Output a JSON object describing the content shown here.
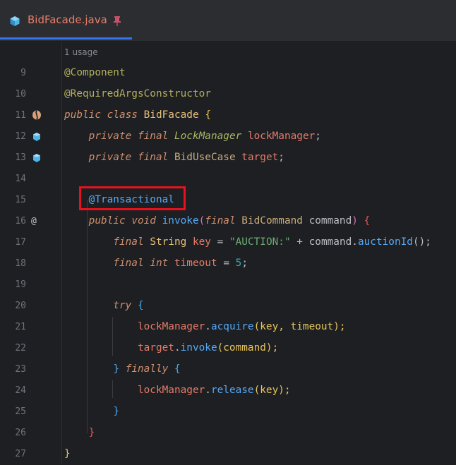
{
  "tab": {
    "title": "BidFacade.java",
    "icon": "java-file-icon",
    "pinned": true
  },
  "editor": {
    "usage_hint": "1 usage",
    "lines": [
      {
        "number": "9",
        "gutter_icon": ""
      },
      {
        "number": "10",
        "gutter_icon": ""
      },
      {
        "number": "11",
        "gutter_icon": "spring-bean-icon"
      },
      {
        "number": "12",
        "gutter_icon": "injection-icon"
      },
      {
        "number": "13",
        "gutter_icon": "injection-icon"
      },
      {
        "number": "14",
        "gutter_icon": ""
      },
      {
        "number": "15",
        "gutter_icon": ""
      },
      {
        "number": "16",
        "gutter_icon": "@"
      },
      {
        "number": "17",
        "gutter_icon": ""
      },
      {
        "number": "18",
        "gutter_icon": ""
      },
      {
        "number": "19",
        "gutter_icon": ""
      },
      {
        "number": "20",
        "gutter_icon": ""
      },
      {
        "number": "21",
        "gutter_icon": ""
      },
      {
        "number": "22",
        "gutter_icon": ""
      },
      {
        "number": "23",
        "gutter_icon": ""
      },
      {
        "number": "24",
        "gutter_icon": ""
      },
      {
        "number": "25",
        "gutter_icon": ""
      },
      {
        "number": "26",
        "gutter_icon": ""
      },
      {
        "number": "27",
        "gutter_icon": ""
      }
    ],
    "code": {
      "l9": {
        "ann": "@Component"
      },
      "l10": {
        "ann": "@RequiredArgsConstructor"
      },
      "l11": {
        "kw1": "public",
        "kw2": "class",
        "cls": "BidFacade",
        "brace": "{"
      },
      "l12": {
        "kw1": "private",
        "kw2": "final",
        "type": "LockManager",
        "field": "lockManager",
        "end": ";"
      },
      "l13": {
        "kw1": "private",
        "kw2": "final",
        "type": "BidUseCase",
        "field": "target",
        "end": ";"
      },
      "l15": {
        "ann": "@Transactional"
      },
      "l16": {
        "kw1": "public",
        "kw2": "void",
        "fn": "invoke",
        "open": "(",
        "kw3": "final",
        "type": "BidCommand",
        "param": "command",
        "close": ")",
        "brace": "{"
      },
      "l17": {
        "kw": "final",
        "type": "String",
        "var": "key",
        "eq": "=",
        "str": "\"AUCTION:\"",
        "plus": "+",
        "obj": "command",
        "dot": ".",
        "fn": "auctionId",
        "call": "();"
      },
      "l18": {
        "kw1": "final",
        "kw2": "int",
        "var": "timeout",
        "eq": "=",
        "num": "5",
        "end": ";"
      },
      "l20": {
        "kw": "try",
        "brace": "{"
      },
      "l21": {
        "obj": "lockManager",
        "dot": ".",
        "fn": "acquire",
        "args": "(key, timeout);"
      },
      "l22": {
        "obj": "target",
        "dot": ".",
        "fn": "invoke",
        "args": "(command);"
      },
      "l23": {
        "close": "}",
        "kw": "finally",
        "brace": "{"
      },
      "l24": {
        "obj": "lockManager",
        "dot": ".",
        "fn": "release",
        "args": "(key);"
      },
      "l25": {
        "close": "}"
      },
      "l26": {
        "close": "}"
      },
      "l27": {
        "close": "}"
      }
    },
    "highlight_color": "#e5131f"
  }
}
